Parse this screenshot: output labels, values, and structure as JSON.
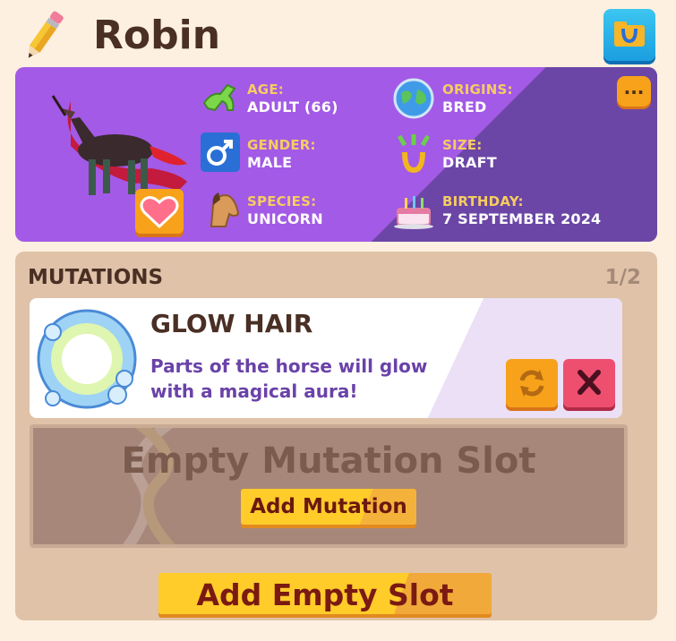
{
  "header": {
    "horse_name": "Robin"
  },
  "stats": {
    "age": {
      "label": "AGE:",
      "value": "ADULT (66)"
    },
    "gender": {
      "label": "GENDER:",
      "value": "MALE"
    },
    "species": {
      "label": "SPECIES:",
      "value": "UNICORN"
    },
    "origins": {
      "label": "ORIGINS:",
      "value": "BRED"
    },
    "size": {
      "label": "SIZE:",
      "value": "DRAFT"
    },
    "birthday": {
      "label": "BIRTHDAY:",
      "value": "7 SEPTEMBER 2024"
    }
  },
  "more_button": {
    "label": "..."
  },
  "mutations": {
    "title": "MUTATIONS",
    "count": "1/2",
    "items": [
      {
        "name": "GLOW HAIR",
        "description": "Parts of the horse will glow with a magical aura!"
      }
    ],
    "empty_slot_label": "Empty Mutation Slot",
    "add_mutation_label": "Add Mutation",
    "add_empty_slot_label": "Add Empty Slot"
  },
  "icons": [
    "pencil-icon",
    "horseshoe-folder-icon",
    "horse-running-icon",
    "male-symbol-icon",
    "horse-head-icon",
    "globe-icon",
    "horseshoe-arrows-icon",
    "birthday-cake-icon",
    "heart-icon",
    "ellipsis-icon",
    "glow-orb-icon",
    "reroll-icon",
    "close-icon",
    "dna-icon"
  ],
  "colors": {
    "card_purple": "#a35ae6",
    "card_dark_purple": "#6b46a6",
    "label_yellow": "#f6cc61",
    "button_orange": "#f7a21a",
    "remove_red": "#ee4f6f",
    "title_brown": "#4a2f24"
  }
}
